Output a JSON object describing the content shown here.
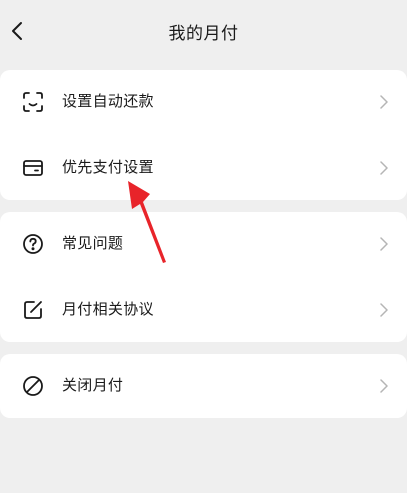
{
  "header": {
    "title": "我的月付",
    "back_icon": "chevron-left-icon"
  },
  "sections": [
    {
      "items": [
        {
          "label": "设置自动还款",
          "icon": "scan-face-icon"
        },
        {
          "label": "优先支付设置",
          "icon": "card-icon"
        }
      ]
    },
    {
      "items": [
        {
          "label": "常见问题",
          "icon": "question-circle-icon"
        },
        {
          "label": "月付相关协议",
          "icon": "edit-document-icon"
        }
      ]
    },
    {
      "items": [
        {
          "label": "关闭月付",
          "icon": "ban-circle-icon"
        }
      ]
    }
  ],
  "colors": {
    "background": "#efefef",
    "card": "#ffffff",
    "text": "#1a1a1a",
    "chevron": "#b5b5b5",
    "annotation_arrow": "#e8242a"
  }
}
